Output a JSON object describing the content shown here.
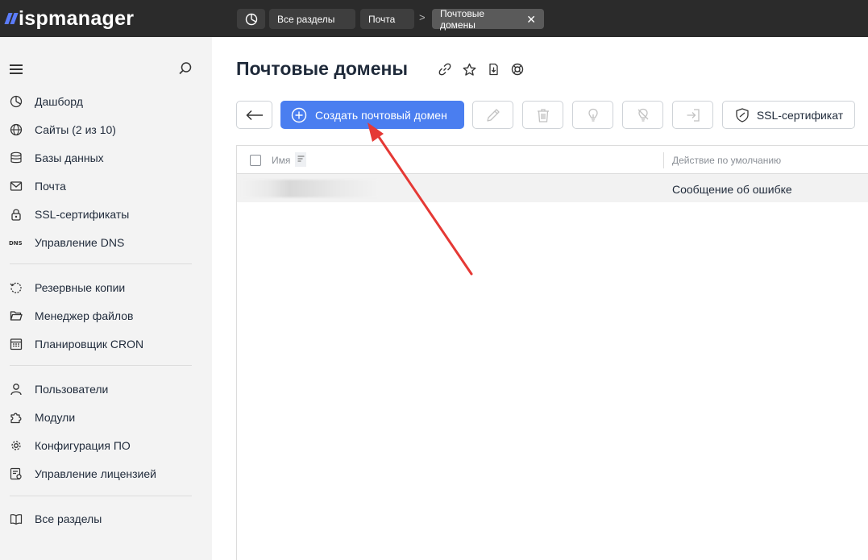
{
  "app": {
    "logo_text": "ispmanager"
  },
  "breadcrumbs": [
    {
      "label": ""
    },
    {
      "label": "Все разделы"
    },
    {
      "label": "Почта"
    },
    {
      "label": "Почтовые домены"
    }
  ],
  "sidebar": {
    "groups": [
      [
        {
          "label": "Дашборд",
          "icon": "dashboard-icon"
        },
        {
          "label": "Сайты (2 из 10)",
          "icon": "globe-icon"
        },
        {
          "label": "Базы данных",
          "icon": "database-icon"
        },
        {
          "label": "Почта",
          "icon": "mail-icon"
        },
        {
          "label": "SSL-сертификаты",
          "icon": "lock-icon"
        },
        {
          "label": "Управление DNS",
          "icon": "dns-icon"
        }
      ],
      [
        {
          "label": "Резервные копии",
          "icon": "backup-icon"
        },
        {
          "label": "Менеджер файлов",
          "icon": "folder-icon"
        },
        {
          "label": "Планировщик CRON",
          "icon": "calendar-icon"
        }
      ],
      [
        {
          "label": "Пользователи",
          "icon": "user-icon"
        },
        {
          "label": "Модули",
          "icon": "puzzle-icon"
        },
        {
          "label": "Конфигурация ПО",
          "icon": "gear-icon"
        },
        {
          "label": "Управление лицензией",
          "icon": "license-icon"
        }
      ],
      [
        {
          "label": "Все разделы",
          "icon": "book-icon"
        }
      ]
    ]
  },
  "page": {
    "title": "Почтовые домены"
  },
  "toolbar": {
    "create_label": "Создать почтовый домен",
    "ssl_label": "SSL-сертификат"
  },
  "table": {
    "columns": {
      "name": "Имя",
      "action": "Действие по умолчанию"
    },
    "rows": [
      {
        "name": "",
        "action": "Сообщение об ошибке"
      }
    ]
  },
  "colors": {
    "accent": "#4a7ef0",
    "topbar": "#2b2b2b",
    "sidebar": "#f3f3f3",
    "annotation_arrow": "#e53935"
  }
}
